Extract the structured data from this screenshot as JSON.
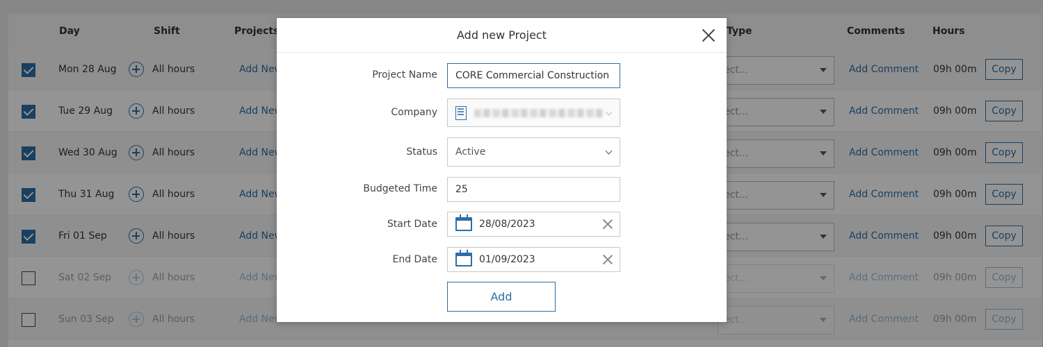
{
  "table": {
    "headers": {
      "day": "Day",
      "shift": "Shift",
      "projects": "Projects",
      "type": "Type",
      "comments": "Comments",
      "hours": "Hours"
    },
    "rows": [
      {
        "day": "Mon 28 Aug",
        "shift": "All hours",
        "project_link": "Add New",
        "type_placeholder": "ect...",
        "comment_link": "Add Comment",
        "hours": "09h 00m",
        "copy_label": "Copy",
        "checked": true
      },
      {
        "day": "Tue 29 Aug",
        "shift": "All hours",
        "project_link": "Add New",
        "type_placeholder": "ect...",
        "comment_link": "Add Comment",
        "hours": "09h 00m",
        "copy_label": "Copy",
        "checked": true
      },
      {
        "day": "Wed 30 Aug",
        "shift": "All hours",
        "project_link": "Add New",
        "type_placeholder": "ect...",
        "comment_link": "Add Comment",
        "hours": "09h 00m",
        "copy_label": "Copy",
        "checked": true
      },
      {
        "day": "Thu 31 Aug",
        "shift": "All hours",
        "project_link": "Add New",
        "type_placeholder": "ect...",
        "comment_link": "Add Comment",
        "hours": "09h 00m",
        "copy_label": "Copy",
        "checked": true
      },
      {
        "day": "Fri 01 Sep",
        "shift": "All hours",
        "project_link": "Add New",
        "type_placeholder": "ect...",
        "comment_link": "Add Comment",
        "hours": "09h 00m",
        "copy_label": "Copy",
        "checked": true
      },
      {
        "day": "Sat 02 Sep",
        "shift": "All hours",
        "project_link": "Add New",
        "type_placeholder": "ect...",
        "comment_link": "Add Comment",
        "hours": "09h 00m",
        "copy_label": "Copy",
        "checked": false
      },
      {
        "day": "Sun 03 Sep",
        "shift": "All hours",
        "project_link": "Add New",
        "type_placeholder": "ect...",
        "comment_link": "Add Comment",
        "hours": "09h 00m",
        "copy_label": "Copy",
        "checked": false
      }
    ]
  },
  "modal": {
    "title": "Add new Project",
    "fields": {
      "project_name": {
        "label": "Project Name",
        "value": "CORE Commercial Construction"
      },
      "company": {
        "label": "Company"
      },
      "status": {
        "label": "Status",
        "value": "Active"
      },
      "budgeted_time": {
        "label": "Budgeted Time",
        "value": "25"
      },
      "start_date": {
        "label": "Start Date",
        "value": "28/08/2023"
      },
      "end_date": {
        "label": "End Date",
        "value": "01/09/2023"
      }
    },
    "add_label": "Add"
  },
  "colors": {
    "accent": "#2c6ea6",
    "overlay": "rgba(0,0,0,0.42)"
  }
}
